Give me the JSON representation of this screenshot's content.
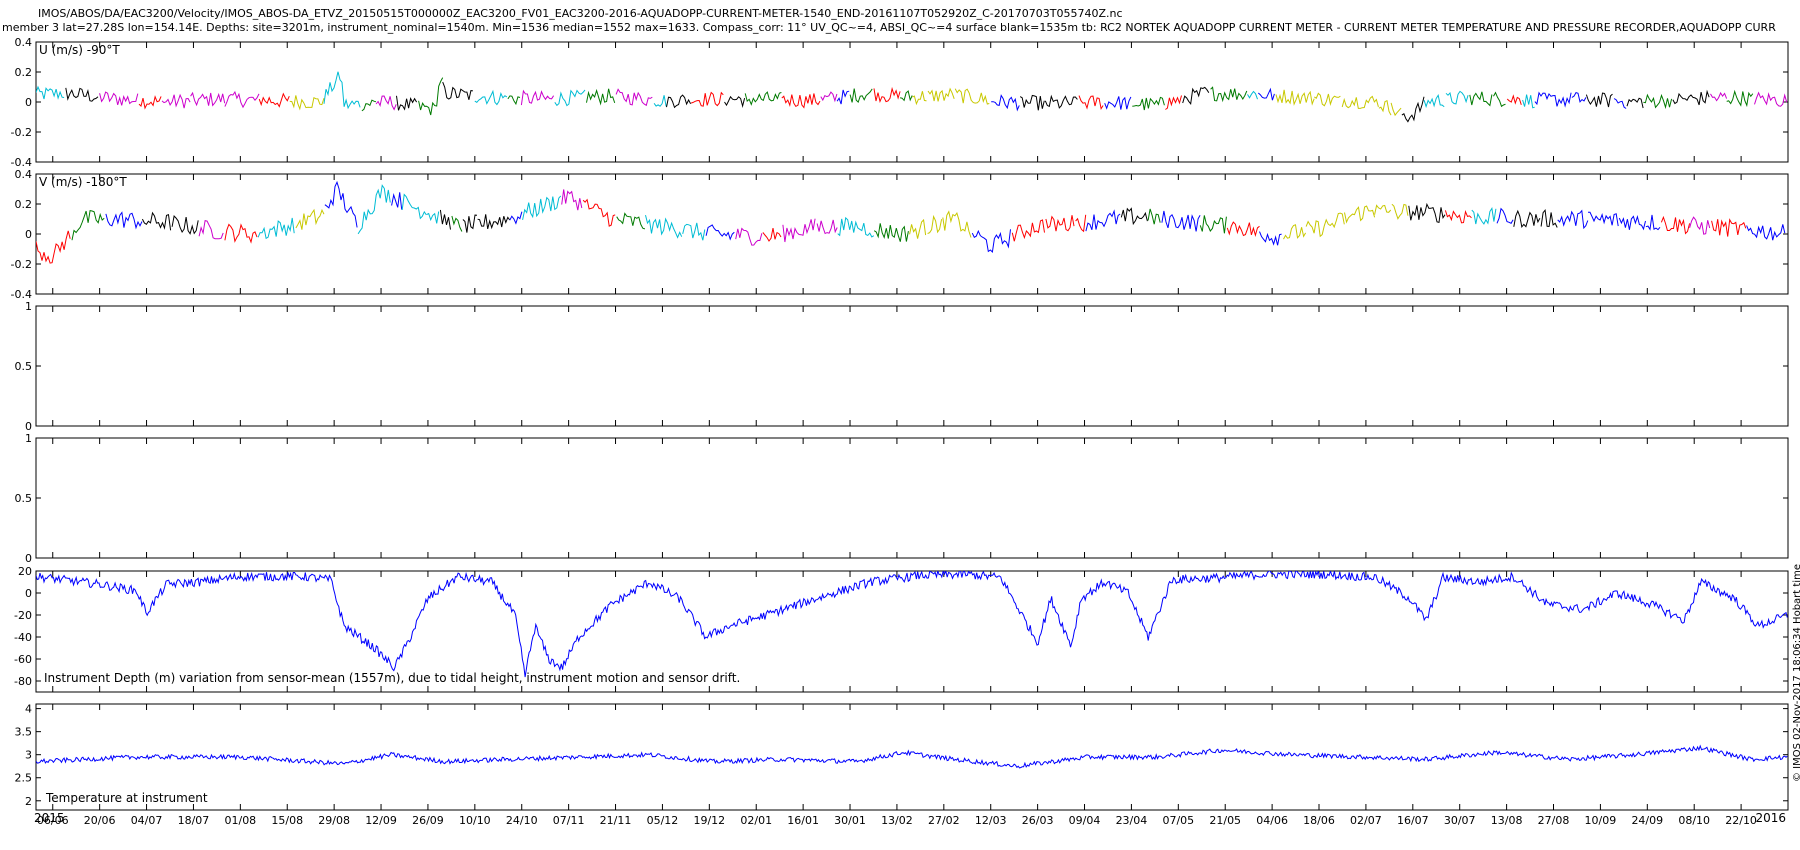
{
  "header": {
    "line1": "IMOS/ABOS/DA/EAC3200/Velocity/IMOS_ABOS-DA_ETVZ_20150515T000000Z_EAC3200_FV01_EAC3200-2016-AQUADOPP-CURRENT-METER-1540_END-20161107T052920Z_C-20170703T055740Z.nc",
    "line2": "member 3 lat=27.28S lon=154.14E. Depths: site=3201m, instrument_nominal=1540m. Min=1536 median=1552 max=1633. Compass_corr: 11° UV_QC~=4, ABSI_QC~=4 surface blank=1535m tb: RC2 NORTEK AQUADOPP CURRENT METER - CURRENT METER TEMPERATURE AND PRESSURE RECORDER,AQUADOPP CURR"
  },
  "watermark": "© IMOS 02-Nov-2017 18:06:34 Hobart time",
  "colors": {
    "axis": "#000000",
    "depth_line": "#0000ff",
    "temp_line": "#0000ff",
    "velocity_palette": [
      "#ff0000",
      "#00bcd4",
      "#cc00cc",
      "#0000ff",
      "#007a00",
      "#000000",
      "#c8c800"
    ]
  },
  "chart_data": [
    {
      "id": "u-velocity",
      "type": "line",
      "panel_label": "U (m/s) -90°T",
      "ylim": [
        -0.4,
        0.4
      ],
      "yticks": [
        -0.4,
        -0.2,
        0,
        0.2,
        0.4
      ],
      "ytick_labels": [
        "-0.4",
        "-0.2",
        "0",
        "0.2",
        "0.4"
      ],
      "xlim": [
        "2015-06-01",
        "2016-11-05"
      ],
      "trace": {
        "x": [
          "2015-06-01",
          "2015-06-10",
          "2015-06-25",
          "2015-07-10",
          "2015-07-25",
          "2015-08-10",
          "2015-08-25",
          "2015-08-31",
          "2015-09-01",
          "2015-09-15",
          "2015-09-28",
          "2015-09-30",
          "2015-10-01",
          "2015-10-15",
          "2015-11-01",
          "2015-11-20",
          "2015-12-05",
          "2015-12-20",
          "2016-01-05",
          "2016-01-20",
          "2016-02-05",
          "2016-02-15",
          "2016-03-01",
          "2016-03-15",
          "2016-04-01",
          "2016-04-15",
          "2016-05-01",
          "2016-05-15",
          "2016-06-01",
          "2016-06-20",
          "2016-07-05",
          "2016-07-15",
          "2016-07-20",
          "2016-08-01",
          "2016-08-20",
          "2016-09-05",
          "2016-09-20",
          "2016-10-05",
          "2016-10-20",
          "2016-11-05"
        ],
        "y": [
          0.05,
          0.06,
          0.02,
          0.0,
          0.02,
          0.01,
          0.0,
          0.18,
          -0.02,
          0.0,
          -0.05,
          0.18,
          0.06,
          0.03,
          0.02,
          0.04,
          0.01,
          0.02,
          0.02,
          0.01,
          0.06,
          0.03,
          0.05,
          0.0,
          -0.01,
          0.0,
          -0.02,
          0.06,
          0.05,
          0.02,
          0.0,
          -0.1,
          0.0,
          0.03,
          0.01,
          0.02,
          0.0,
          0.02,
          0.03,
          0.01
        ]
      },
      "noise_amplitude": 0.05
    },
    {
      "id": "v-velocity",
      "type": "line",
      "panel_label": "V (m/s) -180°T",
      "ylim": [
        -0.4,
        0.4
      ],
      "yticks": [
        -0.4,
        -0.2,
        0,
        0.2,
        0.4
      ],
      "ytick_labels": [
        "-0.4",
        "-0.2",
        "0",
        "0.2",
        "0.4"
      ],
      "xlim": [
        "2015-06-01",
        "2016-11-05"
      ],
      "trace": {
        "x": [
          "2015-06-01",
          "2015-06-06",
          "2015-06-15",
          "2015-06-25",
          "2015-07-10",
          "2015-07-25",
          "2015-08-05",
          "2015-08-15",
          "2015-08-25",
          "2015-08-30",
          "2015-09-05",
          "2015-09-12",
          "2015-09-25",
          "2015-10-05",
          "2015-10-20",
          "2015-11-01",
          "2015-11-07",
          "2015-11-20",
          "2015-12-05",
          "2015-12-20",
          "2016-01-05",
          "2016-01-20",
          "2016-02-01",
          "2016-02-15",
          "2016-03-01",
          "2016-03-12",
          "2016-03-25",
          "2016-04-10",
          "2016-04-25",
          "2016-05-10",
          "2016-05-25",
          "2016-06-05",
          "2016-06-20",
          "2016-07-01",
          "2016-07-15",
          "2016-08-01",
          "2016-08-20",
          "2016-09-05",
          "2016-09-25",
          "2016-10-10",
          "2016-10-25",
          "2016-11-05"
        ],
        "y": [
          -0.1,
          -0.15,
          0.1,
          0.1,
          0.08,
          0.02,
          0.0,
          0.05,
          0.12,
          0.3,
          0.05,
          0.28,
          0.15,
          0.05,
          0.1,
          0.2,
          0.25,
          0.1,
          0.05,
          0.0,
          -0.02,
          0.05,
          0.05,
          0.0,
          0.1,
          -0.08,
          0.05,
          0.08,
          0.12,
          0.08,
          0.05,
          -0.02,
          0.05,
          0.15,
          0.15,
          0.12,
          0.1,
          0.1,
          0.08,
          0.05,
          0.03,
          0.0
        ]
      },
      "noise_amplitude": 0.06
    },
    {
      "id": "empty-panel-1",
      "type": "line",
      "ylim": [
        0,
        1
      ],
      "yticks": [
        0,
        0.5,
        1
      ],
      "ytick_labels": [
        "0",
        "0.5",
        "1"
      ],
      "xlim": [
        "2015-06-01",
        "2016-11-05"
      ]
    },
    {
      "id": "empty-panel-2",
      "type": "line",
      "ylim": [
        0,
        1
      ],
      "yticks": [
        0,
        0.5,
        1
      ],
      "ytick_labels": [
        "0",
        "0.5",
        "1"
      ],
      "xlim": [
        "2015-06-01",
        "2016-11-05"
      ]
    },
    {
      "id": "depth-variation",
      "type": "line",
      "panel_label": "Instrument Depth (m) variation from sensor-mean (1557m), due to tidal height, instrument motion and sensor drift.",
      "ylim": [
        -90,
        20
      ],
      "yticks": [
        -80,
        -60,
        -40,
        -20,
        0,
        20
      ],
      "ytick_labels": [
        "-80",
        "-60",
        "-40",
        "-20",
        "0",
        "20"
      ],
      "xlim": [
        "2015-06-01",
        "2016-11-05"
      ],
      "trace": {
        "x": [
          "2015-06-01",
          "2015-06-20",
          "2015-07-01",
          "2015-07-04",
          "2015-07-10",
          "2015-07-20",
          "2015-08-01",
          "2015-08-20",
          "2015-08-28",
          "2015-09-01",
          "2015-09-10",
          "2015-09-16",
          "2015-09-20",
          "2015-09-26",
          "2015-10-05",
          "2015-10-15",
          "2015-10-22",
          "2015-10-25",
          "2015-10-28",
          "2015-11-01",
          "2015-11-05",
          "2015-11-10",
          "2015-11-20",
          "2015-12-01",
          "2015-12-10",
          "2015-12-18",
          "2015-12-25",
          "2016-01-05",
          "2016-01-20",
          "2016-02-05",
          "2016-02-20",
          "2016-03-05",
          "2016-03-15",
          "2016-03-26",
          "2016-03-30",
          "2016-04-05",
          "2016-04-08",
          "2016-04-15",
          "2016-04-22",
          "2016-04-28",
          "2016-05-05",
          "2016-05-20",
          "2016-06-01",
          "2016-06-20",
          "2016-07-05",
          "2016-07-15",
          "2016-07-20",
          "2016-07-25",
          "2016-08-05",
          "2016-08-15",
          "2016-08-25",
          "2016-09-05",
          "2016-09-15",
          "2016-09-25",
          "2016-10-05",
          "2016-10-10",
          "2016-10-20",
          "2016-10-27",
          "2016-11-05"
        ],
        "y": [
          15,
          8,
          2,
          -18,
          8,
          10,
          15,
          15,
          12,
          -30,
          -50,
          -68,
          -45,
          -5,
          15,
          10,
          -20,
          -75,
          -30,
          -60,
          -68,
          -40,
          -10,
          10,
          -5,
          -40,
          -30,
          -20,
          -5,
          10,
          16,
          17,
          14,
          -45,
          -5,
          -48,
          -5,
          10,
          0,
          -40,
          12,
          14,
          17,
          17,
          14,
          -5,
          -25,
          14,
          10,
          15,
          -10,
          -15,
          0,
          -10,
          -25,
          10,
          -5,
          -30,
          -20
        ]
      },
      "noise_amplitude": 4
    },
    {
      "id": "temperature",
      "type": "line",
      "panel_label": "Temperature at instrument",
      "ylim": [
        1.8,
        4.1
      ],
      "yticks": [
        2,
        2.5,
        3,
        3.5,
        4
      ],
      "ytick_labels": [
        "2",
        "2.5",
        "3",
        "3.5",
        "4"
      ],
      "xlim": [
        "2015-06-01",
        "2016-11-05"
      ],
      "trace": {
        "x": [
          "2015-06-01",
          "2015-07-01",
          "2015-08-01",
          "2015-09-01",
          "2015-09-15",
          "2015-10-01",
          "2015-10-20",
          "2015-11-10",
          "2015-12-01",
          "2015-12-20",
          "2016-01-10",
          "2016-02-01",
          "2016-02-15",
          "2016-03-01",
          "2016-03-20",
          "2016-04-10",
          "2016-05-01",
          "2016-05-20",
          "2016-06-10",
          "2016-07-01",
          "2016-07-20",
          "2016-08-10",
          "2016-09-01",
          "2016-09-20",
          "2016-10-10",
          "2016-10-25",
          "2016-11-05"
        ],
        "y": [
          2.85,
          2.95,
          2.95,
          2.8,
          3.0,
          2.85,
          2.9,
          2.95,
          3.0,
          2.85,
          2.9,
          2.85,
          3.05,
          2.9,
          2.75,
          2.95,
          2.95,
          3.1,
          3.0,
          2.95,
          2.9,
          3.05,
          2.9,
          3.0,
          3.15,
          2.9,
          2.95
        ]
      },
      "noise_amplitude": 0.05
    }
  ],
  "x_axis": {
    "year_start_label": "2015",
    "year_end_label": "2016",
    "ticks": [
      {
        "date": "2015-06-06",
        "label": "06/06"
      },
      {
        "date": "2015-06-20",
        "label": "20/06"
      },
      {
        "date": "2015-07-04",
        "label": "04/07"
      },
      {
        "date": "2015-07-18",
        "label": "18/07"
      },
      {
        "date": "2015-08-01",
        "label": "01/08"
      },
      {
        "date": "2015-08-15",
        "label": "15/08"
      },
      {
        "date": "2015-08-29",
        "label": "29/08"
      },
      {
        "date": "2015-09-12",
        "label": "12/09"
      },
      {
        "date": "2015-09-26",
        "label": "26/09"
      },
      {
        "date": "2015-10-10",
        "label": "10/10"
      },
      {
        "date": "2015-10-24",
        "label": "24/10"
      },
      {
        "date": "2015-11-07",
        "label": "07/11"
      },
      {
        "date": "2015-11-21",
        "label": "21/11"
      },
      {
        "date": "2015-12-05",
        "label": "05/12"
      },
      {
        "date": "2015-12-19",
        "label": "19/12"
      },
      {
        "date": "2016-01-02",
        "label": "02/01"
      },
      {
        "date": "2016-01-16",
        "label": "16/01"
      },
      {
        "date": "2016-01-30",
        "label": "30/01"
      },
      {
        "date": "2016-02-13",
        "label": "13/02"
      },
      {
        "date": "2016-02-27",
        "label": "27/02"
      },
      {
        "date": "2016-03-12",
        "label": "12/03"
      },
      {
        "date": "2016-03-26",
        "label": "26/03"
      },
      {
        "date": "2016-04-09",
        "label": "09/04"
      },
      {
        "date": "2016-04-23",
        "label": "23/04"
      },
      {
        "date": "2016-05-07",
        "label": "07/05"
      },
      {
        "date": "2016-05-21",
        "label": "21/05"
      },
      {
        "date": "2016-06-04",
        "label": "04/06"
      },
      {
        "date": "2016-06-18",
        "label": "18/06"
      },
      {
        "date": "2016-07-02",
        "label": "02/07"
      },
      {
        "date": "2016-07-16",
        "label": "16/07"
      },
      {
        "date": "2016-07-30",
        "label": "30/07"
      },
      {
        "date": "2016-08-13",
        "label": "13/08"
      },
      {
        "date": "2016-08-27",
        "label": "27/08"
      },
      {
        "date": "2016-09-10",
        "label": "10/09"
      },
      {
        "date": "2016-09-24",
        "label": "24/09"
      },
      {
        "date": "2016-10-08",
        "label": "08/10"
      },
      {
        "date": "2016-10-22",
        "label": "22/10"
      }
    ]
  }
}
